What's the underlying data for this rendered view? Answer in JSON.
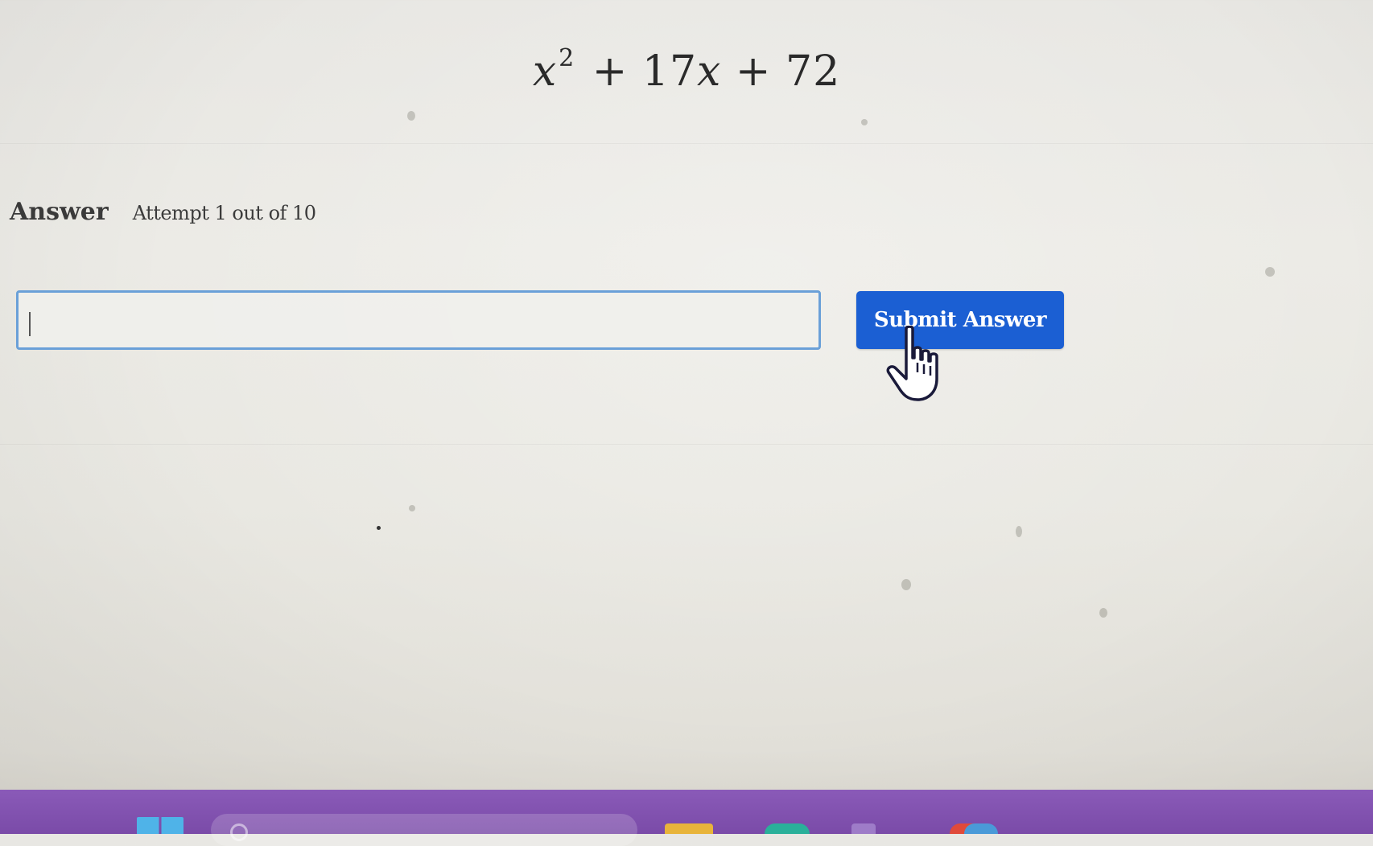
{
  "problem": {
    "expression": {
      "var": "x",
      "exponent": "2",
      "rest": "+ 17",
      "var2": "x",
      "tail": "+ 72"
    }
  },
  "answer_section": {
    "label": "Answer",
    "attempt": "Attempt 1 out of 10",
    "input_value": "",
    "input_placeholder": ""
  },
  "submit": {
    "label": "Submit Answer",
    "color": "#1b5fd3"
  },
  "taskbar": {
    "color": "#7a4ba8",
    "icons": [
      "windows-start-icon",
      "search-icon",
      "file-explorer-icon",
      "edge-browser-icon",
      "store-icon",
      "chrome-icon",
      "teams-icon"
    ]
  },
  "cursor": {
    "icon": "hand-pointer-icon"
  }
}
